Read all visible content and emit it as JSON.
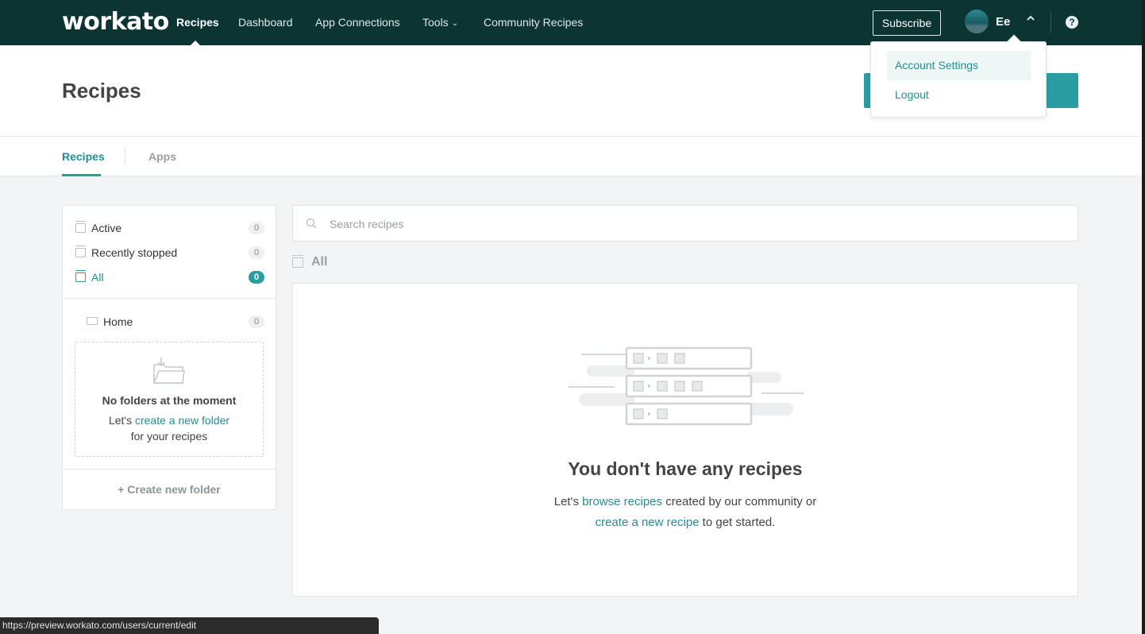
{
  "nav": {
    "logo": "workato",
    "links": [
      "Recipes",
      "Dashboard",
      "App Connections",
      "Tools",
      "Community Recipes"
    ],
    "subscribe": "Subscribe",
    "user_name": "Ee",
    "user_caret": "⌃",
    "help": "?"
  },
  "user_menu": {
    "items": [
      "Account Settings",
      "Logout"
    ]
  },
  "header": {
    "title": "Recipes"
  },
  "tabs": [
    "Recipes",
    "Apps"
  ],
  "sidebar": {
    "filters": [
      {
        "label": "Active",
        "count": "0"
      },
      {
        "label": "Recently stopped",
        "count": "0"
      },
      {
        "label": "All",
        "count": "0"
      }
    ],
    "folder": {
      "label": "Home",
      "count": "0"
    },
    "empty_folders": {
      "title": "No folders at the moment",
      "line1_prefix": "Let's",
      "line1_link": "create a new folder",
      "line2": "for your recipes"
    },
    "create_folder": "+ Create new folder"
  },
  "search": {
    "placeholder": "Search recipes"
  },
  "list_heading": "All",
  "empty_state": {
    "title": "You don't have any recipes",
    "line1_prefix": "Let's",
    "line1_link": "browse recipes",
    "line1_suffix": "created by our community or",
    "line2_link": "create a new recipe",
    "line2_suffix": "to get started."
  },
  "status_bar": {
    "url": "https://preview.workato.com/users/current/edit"
  },
  "colors": {
    "nav_bg": "#0b3433",
    "accent": "#2a9da3",
    "link": "#228f95"
  }
}
